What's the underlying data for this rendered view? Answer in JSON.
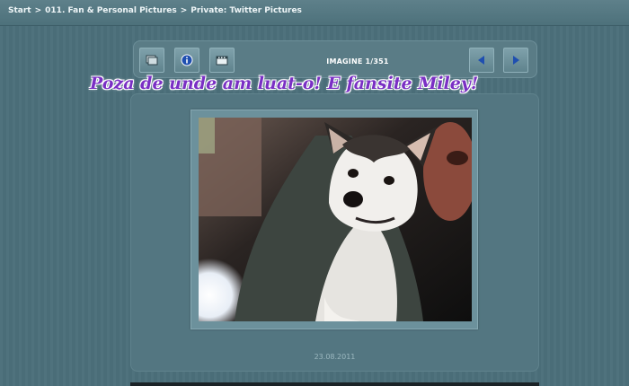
{
  "breadcrumb": {
    "start": "Start",
    "separator": ">",
    "category": "011. Fan & Personal Pictures",
    "album": "Private: Twitter Pictures"
  },
  "toolbar": {
    "counter": "IMAGINE 1/351",
    "buttons": [
      "slideshow-icon",
      "info-icon",
      "film-icon",
      "prev-arrow-icon",
      "next-arrow-icon"
    ]
  },
  "caption_overlay": "Poza de unde am luat-o! E fansite Miley!",
  "photo": {
    "date": "23.08.2011"
  },
  "colors": {
    "background": "#4b6f7a",
    "panel": "#537681",
    "caption": "#7a2fc4",
    "arrow": "#1f4fb0"
  }
}
